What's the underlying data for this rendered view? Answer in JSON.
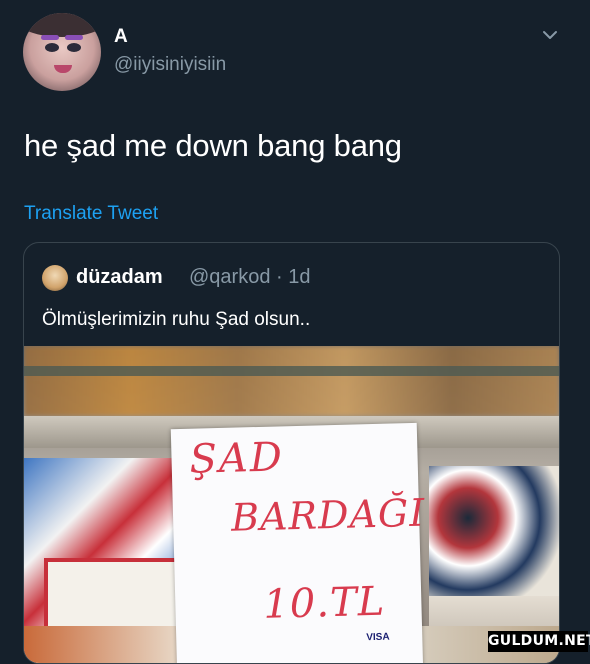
{
  "tweet": {
    "author": {
      "name": "A",
      "handle": "@iiyisiniyisiin"
    },
    "text": "he şad me down bang bang",
    "translate_label": "Translate Tweet"
  },
  "quoted_tweet": {
    "author": {
      "name": "düzadam",
      "handle": "@qarkod · 1d"
    },
    "text": "Ölmüşlerimizin ruhu Şad olsun..",
    "image": {
      "sign_lines": [
        "ŞAD",
        "BARDAĞI",
        "10.TL"
      ],
      "card_brand": "VISA"
    }
  },
  "watermark": "GULDUM.NET",
  "colors": {
    "background": "#15202b",
    "secondary_text": "#8899a6",
    "link": "#1da1f2",
    "border": "#38444d",
    "sign_ink": "#d83b4e"
  },
  "icons": {
    "chevron": "chevron-down-icon"
  }
}
